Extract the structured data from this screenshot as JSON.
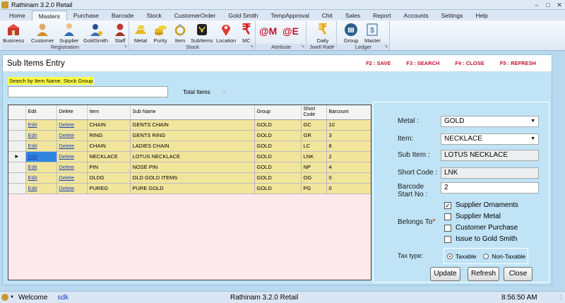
{
  "window": {
    "title": "Rathinam 3.2.0 Retail"
  },
  "menu": [
    "Home",
    "Masters",
    "Purchase",
    "Barcode",
    "Stock",
    "CustomerOrder",
    "Gold Smith",
    "TempApproval",
    "Chit",
    "Sales",
    "Report",
    "Accounts",
    "Settings",
    "Help"
  ],
  "menu_active": "Masters",
  "ribbon": {
    "groups": {
      "registration": "Registration",
      "stock": "Stock",
      "attribute": "Attribute",
      "jwell_rate": "Jwell Rate",
      "ledger": "Ledger"
    },
    "buttons": {
      "business": "Business",
      "customer": "Customer",
      "supplier": "Supplier",
      "goldsmith": "GoldSmith",
      "staff": "Staff",
      "metal": "Metal",
      "purity": "Purity",
      "item": "Item",
      "subitems": "SubItems",
      "location": "Location",
      "mc": "MC",
      "at_m": "@M",
      "at_e": "@E",
      "daily": "Daily",
      "group": "Group",
      "master": "Master"
    }
  },
  "page": {
    "title": "Sub Items Entry",
    "shortcuts": [
      "F2 : SAVE",
      "F3 : SEARCH",
      "F4 : CLOSE",
      "F5 : REFRESH"
    ],
    "search_hint": "Search by Item Name, Stock Group",
    "search_value": "",
    "total_label": "Total Items",
    "total_value": "-"
  },
  "grid": {
    "headers": [
      "Edit",
      "Delete",
      "Item",
      "Sub Name",
      "Group",
      "Short Code",
      "Barcount"
    ],
    "rows": [
      {
        "edit": "Edit",
        "delete": "Delete",
        "item": "CHAIN",
        "sub_name": "GENTS CHAIN",
        "group": "GOLD",
        "short_code": "GC",
        "barcount": "10"
      },
      {
        "edit": "Edit",
        "delete": "Delete",
        "item": "RING",
        "sub_name": "GENTS RING",
        "group": "GOLD",
        "short_code": "GR",
        "barcount": "3"
      },
      {
        "edit": "Edit",
        "delete": "Delete",
        "item": "CHAIN",
        "sub_name": "LADIES CHAIN",
        "group": "GOLD",
        "short_code": "LC",
        "barcount": "8"
      },
      {
        "edit": "Edit",
        "delete": "Delete",
        "item": "NECKLACE",
        "sub_name": "LOTUS NECKLACE",
        "group": "GOLD",
        "short_code": "LNK",
        "barcount": "2"
      },
      {
        "edit": "Edit",
        "delete": "Delete",
        "item": "PIN",
        "sub_name": "NOSE PIN",
        "group": "GOLD",
        "short_code": "NP",
        "barcount": "4"
      },
      {
        "edit": "Edit",
        "delete": "Delete",
        "item": "OLDG",
        "sub_name": "OLD GOLD ITEMS",
        "group": "GOLD",
        "short_code": "OG",
        "barcount": "0"
      },
      {
        "edit": "Edit",
        "delete": "Delete",
        "item": "PUREG",
        "sub_name": "PURE GOLD",
        "group": "GOLD",
        "short_code": "PG",
        "barcount": "0"
      }
    ],
    "selected_row": 3
  },
  "form": {
    "metal_label": "Metal  :",
    "metal_value": "GOLD",
    "item_label": "Item:",
    "item_value": "NECKLACE",
    "subitem_label": "Sub Item :",
    "subitem_value": "LOTUS NECKLACE",
    "shortcode_label": "Short Code :",
    "shortcode_value": "LNK",
    "barcode_label_1": "Barcode",
    "barcode_label_2": "Start No :",
    "barcode_value": "2",
    "belongs_label": "Belongs To",
    "required_mark": "*",
    "belongs_options": [
      {
        "label": "Supplier Ornaments",
        "checked": true
      },
      {
        "label": "Supplier Metal",
        "checked": false
      },
      {
        "label": "Customer Purchase",
        "checked": false
      },
      {
        "label": "Issue to Gold Smith",
        "checked": false
      }
    ],
    "tax_label": "Tax type:",
    "tax_options": [
      {
        "label": "Taxable",
        "selected": true
      },
      {
        "label": "Non-Taxable",
        "selected": false
      }
    ],
    "buttons": {
      "update": "Update",
      "refresh": "Refresh",
      "close": "Close"
    }
  },
  "status": {
    "welcome": "Welcome",
    "user": "sdk",
    "app": "Rathinam 3.2.0 Retail",
    "time": "8:56:50 AM"
  },
  "colors": {
    "background": "#b9d9ee",
    "grid_row": "#f1e59c",
    "grid_empty": "#fde8ec",
    "shortcut_text": "#c8102e",
    "search_hint_bg": "#ffff44",
    "link": "#1f3fbf"
  }
}
